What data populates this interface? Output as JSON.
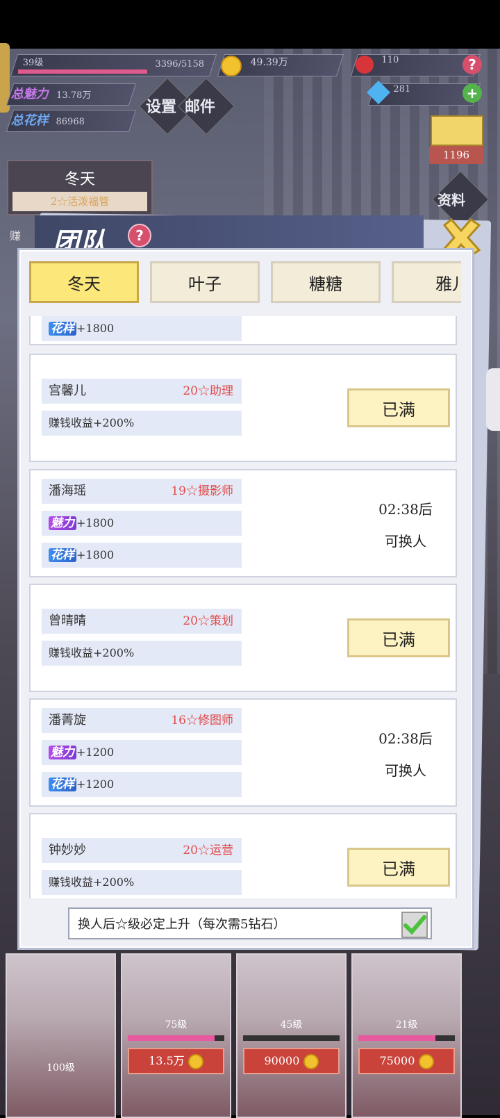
{
  "hud": {
    "level": "39级",
    "exp": "3396/5158",
    "level_progress": 0.66,
    "coins": "49.39万",
    "roses": "110",
    "diamonds": "281",
    "total_charm_label": "总魅力",
    "total_charm": "13.78万",
    "total_style_label": "总花样",
    "total_style": "86968",
    "settings_label": "设置",
    "mail_label": "邮件",
    "rank_value": "1196",
    "info_label": "资料",
    "current_girl_name": "冬天",
    "current_girl_title": "2☆活泼福管",
    "side_text": "赚"
  },
  "modal": {
    "title": "团队",
    "help": "?",
    "tabs": [
      "冬天",
      "叶子",
      "糖糖",
      "雅儿"
    ],
    "active_tab": 0,
    "cards": [
      {
        "name": "",
        "title": "",
        "stats": [
          {
            "badge": "花样",
            "kind": "style",
            "value": "+1800"
          }
        ],
        "action": "",
        "partial": true
      },
      {
        "name": "宫馨儿",
        "title": "20☆助理",
        "stats": [
          {
            "text": "赚钱收益+200%"
          }
        ],
        "action": "已满"
      },
      {
        "name": "潘海瑶",
        "title": "19☆摄影师",
        "stats": [
          {
            "badge": "魅力",
            "kind": "charm",
            "value": "+1800"
          },
          {
            "badge": "花样",
            "kind": "style",
            "value": "+1800"
          }
        ],
        "timer": "02:38后",
        "timer_sub": "可换人"
      },
      {
        "name": "曾晴晴",
        "title": "20☆策划",
        "stats": [
          {
            "text": "赚钱收益+200%"
          }
        ],
        "action": "已满"
      },
      {
        "name": "潘菁旋",
        "title": "16☆修图师",
        "stats": [
          {
            "badge": "魅力",
            "kind": "charm",
            "value": "+1200"
          },
          {
            "badge": "花样",
            "kind": "style",
            "value": "+1200"
          }
        ],
        "timer": "02:38后",
        "timer_sub": "可换人"
      },
      {
        "name": "钟妙妙",
        "title": "20☆运营",
        "stats": [
          {
            "text": "赚钱收益+200%"
          }
        ],
        "action": "已满"
      }
    ],
    "footer_text": "换人后☆级必定上升（每次需5钻石）",
    "footer_checked": true
  },
  "girls": [
    {
      "level": "100级",
      "progress": 1.0,
      "price": ""
    },
    {
      "level": "75级",
      "progress": 0.9,
      "price": "13.5万"
    },
    {
      "level": "45级",
      "progress": 0.0,
      "price": "90000"
    },
    {
      "level": "21级",
      "progress": 0.8,
      "price": "75000"
    }
  ],
  "colors": {
    "accent_pink": "#e05a8e",
    "tab_active": "#fbe77a",
    "title_red": "#e24b4b",
    "charm_purple": "#b44ce8",
    "style_blue": "#3e8ef0"
  }
}
